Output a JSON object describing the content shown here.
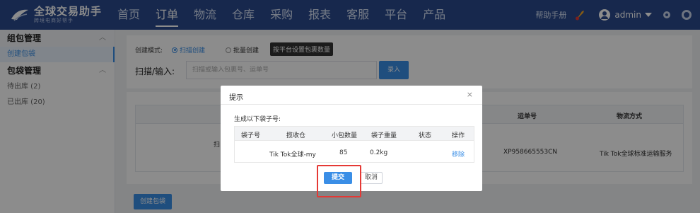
{
  "app": {
    "logo_title": "全球交易助手",
    "logo_sub": "跨境电商好帮手",
    "brand_color": "#2a4a8d",
    "accent_color": "#3a8ee6"
  },
  "nav": {
    "items": [
      "首页",
      "订单",
      "物流",
      "仓库",
      "采购",
      "报表",
      "客服",
      "平台",
      "产品"
    ],
    "active": "订单"
  },
  "topright": {
    "help": "帮助手册",
    "user": "admin",
    "icons": [
      "rocket-icon",
      "user-icon",
      "gear-icon",
      "circle-icon"
    ]
  },
  "sidebar": {
    "group1": "组包管理",
    "group1_items": [
      "创建包袋"
    ],
    "group2": "包袋管理",
    "group2_items": [
      "待出库 (2)",
      "已出库 (20)"
    ]
  },
  "form": {
    "mode_label": "创建模式:",
    "radio_scan": "扫描创建",
    "radio_batch": "批量创建",
    "settings_link": "设置",
    "tooltip": "按平台设置包裹数量",
    "scan_label": "扫描/输入:",
    "scan_placeholder": "扫描或输入包裹号、运单号",
    "enter_button": "录入"
  },
  "bg_table": {
    "col_waybill": "运单号",
    "col_logistics": "物流方式",
    "row_partial": "扫",
    "row_waybill": "XP958665553CN",
    "row_logistics": "Tik Tok全球标准运输服务"
  },
  "create_button": "创建包袋",
  "modal": {
    "title": "提示",
    "close": "×",
    "subtitle": "生成以下袋子号:",
    "headers": [
      "袋子号",
      "揽收仓",
      "小包数量",
      "袋子重量",
      "状态",
      "操作"
    ],
    "row": {
      "bag_no": "",
      "warehouse": "Tik Tok全球-my",
      "count": "85",
      "weight": "0.2kg",
      "status": "",
      "action": "移除"
    },
    "submit": "提交",
    "cancel": "取消"
  }
}
